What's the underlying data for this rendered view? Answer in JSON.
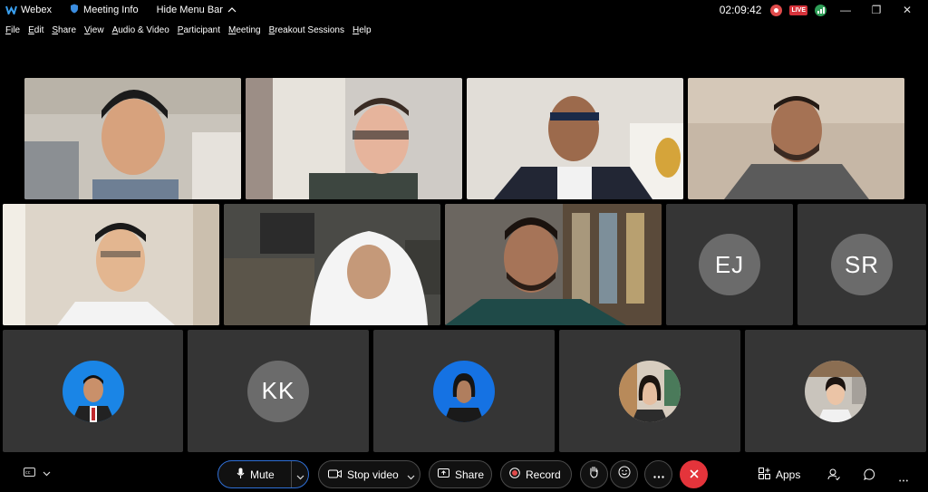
{
  "titlebar": {
    "app_name": "Webex",
    "meeting_info": "Meeting Info",
    "hide_menu": "Hide Menu Bar",
    "clock": "02:09:42",
    "live_label": "LIVE"
  },
  "menu": [
    "File",
    "Edit",
    "Share",
    "View",
    "Audio & Video",
    "Participant",
    "Meeting",
    "Breakout Sessions",
    "Help"
  ],
  "participants_initials": {
    "ej": "EJ",
    "sr": "SR",
    "kk": "KK"
  },
  "toolbar": {
    "mute": "Mute",
    "stop_video": "Stop video",
    "share": "Share",
    "record": "Record",
    "apps": "Apps"
  },
  "colors": {
    "end_call": "#e4343b",
    "record_red": "#e04b4b",
    "live_badge": "#d6333b",
    "tile_bg": "#353535",
    "initial_avatar": "#6b6b6b"
  }
}
